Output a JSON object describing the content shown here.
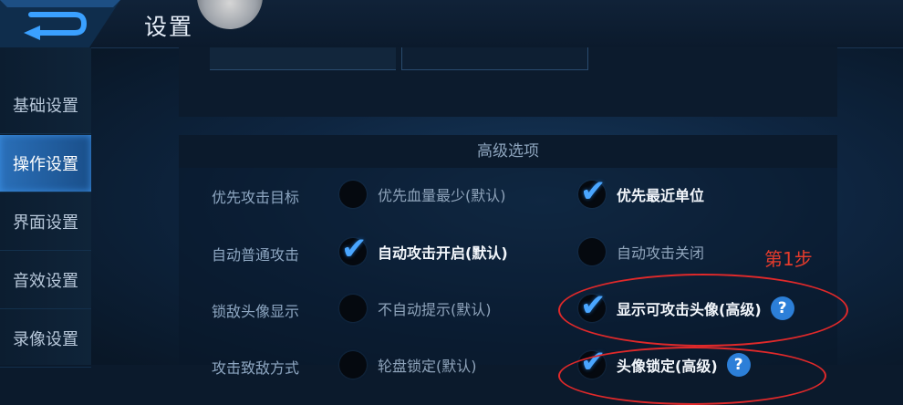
{
  "header": {
    "title": "设置"
  },
  "sidebar": {
    "items": [
      {
        "label": "基础设置"
      },
      {
        "label": "操作设置"
      },
      {
        "label": "界面设置"
      },
      {
        "label": "音效设置"
      },
      {
        "label": "录像设置"
      }
    ],
    "active_index": 1
  },
  "advanced": {
    "title": "高级选项",
    "rows": [
      {
        "label": "优先攻击目标",
        "opt1": "优先血量最少(默认)",
        "opt2": "优先最近单位",
        "selected": 2
      },
      {
        "label": "自动普通攻击",
        "opt1": "自动攻击开启(默认)",
        "opt2": "自动攻击关闭",
        "selected": 1
      },
      {
        "label": "锁敌头像显示",
        "opt1": "不自动提示(默认)",
        "opt2": "显示可攻击头像(高级)",
        "selected": 2
      },
      {
        "label": "攻击致敌方式",
        "opt1": "轮盘锁定(默认)",
        "opt2": "头像锁定(高级)",
        "selected": 2
      }
    ]
  },
  "annotation": {
    "step_label": "第1步"
  },
  "colors": {
    "accent": "#2c7fd8",
    "highlight": "#e0292a",
    "active_tab": "#2a6fb8"
  },
  "icons": {
    "back": "back-arrow-icon",
    "check": "checkmark-icon",
    "help": "question-mark-icon"
  }
}
